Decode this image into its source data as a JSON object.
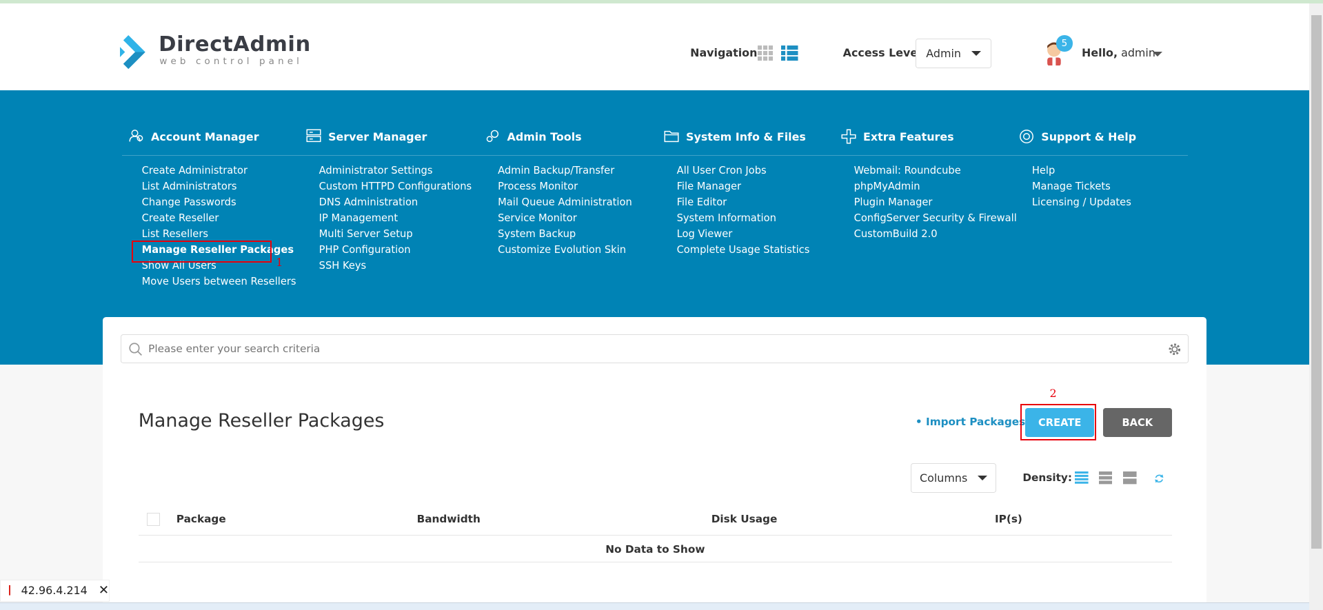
{
  "logo": {
    "title": "DirectAdmin",
    "subtitle": "web control panel"
  },
  "header": {
    "navigation_label": "Navigation",
    "access_level_label": "Access Level",
    "access_level_value": "Admin",
    "notification_count": "5",
    "greeting": "Hello,",
    "username": "admin"
  },
  "menu": [
    {
      "title": "Account Manager",
      "icon": "users-icon",
      "items": [
        "Create Administrator",
        "List Administrators",
        "Change Passwords",
        "Create Reseller",
        "List Resellers",
        "Manage Reseller Packages",
        "Show All Users",
        "Move Users between Resellers"
      ]
    },
    {
      "title": "Server Manager",
      "icon": "server-icon",
      "items": [
        "Administrator Settings",
        "Custom HTTPD Configurations",
        "DNS Administration",
        "IP Management",
        "Multi Server Setup",
        "PHP Configuration",
        "SSH Keys"
      ]
    },
    {
      "title": "Admin Tools",
      "icon": "gears-icon",
      "items": [
        "Admin Backup/Transfer",
        "Process Monitor",
        "Mail Queue Administration",
        "Service Monitor",
        "System Backup",
        "Customize Evolution Skin"
      ]
    },
    {
      "title": "System Info & Files",
      "icon": "folder-icon",
      "items": [
        "All User Cron Jobs",
        "File Manager",
        "File Editor",
        "System Information",
        "Log Viewer",
        "Complete Usage Statistics"
      ]
    },
    {
      "title": "Extra Features",
      "icon": "plus-icon",
      "items": [
        "Webmail: Roundcube",
        "phpMyAdmin",
        "Plugin Manager",
        "ConfigServer Security & Firewall",
        "CustomBuild 2.0"
      ]
    },
    {
      "title": "Support & Help",
      "icon": "lifebuoy-icon",
      "items": [
        "Help",
        "Manage Tickets",
        "Licensing / Updates"
      ]
    }
  ],
  "search": {
    "placeholder": "Please enter your search criteria"
  },
  "page": {
    "title": "Manage Reseller Packages",
    "import_label": "• Import Packages",
    "create_label": "CREATE",
    "back_label": "BACK",
    "columns_label": "Columns",
    "density_label": "Density:"
  },
  "table": {
    "headers": [
      "Package",
      "Bandwidth",
      "Disk Usage",
      "IP(s)"
    ],
    "empty": "No Data to Show"
  },
  "annotations": {
    "one": "1",
    "two": "2"
  },
  "ip_tag": {
    "ip": "42.96.4.214"
  },
  "colors": {
    "brand_blue": "#0083b5",
    "create": "#3bb4e8",
    "back": "#666666",
    "highlight": "#e8000b"
  }
}
